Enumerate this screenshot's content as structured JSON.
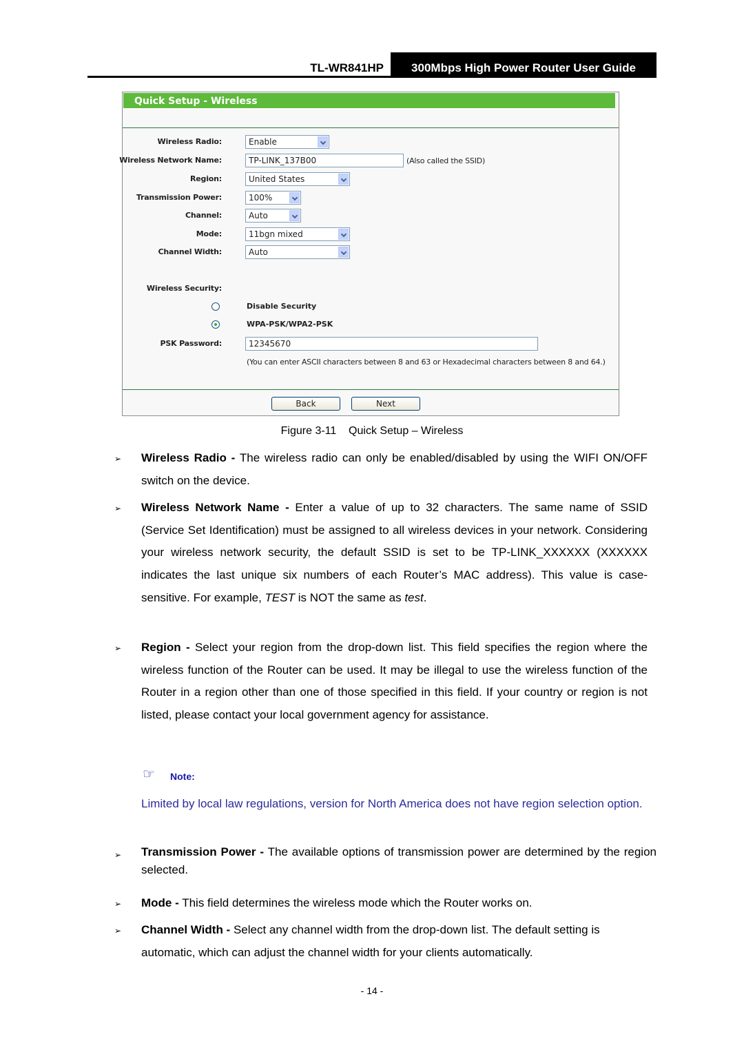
{
  "header": {
    "model": "TL-WR841HP",
    "guide_title": "300Mbps High Power Router User Guide"
  },
  "panel": {
    "title": "Quick Setup - Wireless",
    "fields": {
      "wireless_radio": {
        "label": "Wireless Radio:",
        "value": "Enable"
      },
      "network_name": {
        "label": "Wireless Network Name:",
        "value": "TP-LINK_137B00",
        "hint": "(Also called the SSID)"
      },
      "region": {
        "label": "Region:",
        "value": "United States"
      },
      "tx_power": {
        "label": "Transmission Power:",
        "value": "100%"
      },
      "channel": {
        "label": "Channel:",
        "value": "Auto"
      },
      "mode": {
        "label": "Mode:",
        "value": "11bgn mixed"
      },
      "channel_width": {
        "label": "Channel Width:",
        "value": "Auto"
      }
    },
    "security": {
      "label": "Wireless Security:",
      "options": [
        {
          "label": "Disable Security",
          "selected": false
        },
        {
          "label": "WPA-PSK/WPA2-PSK",
          "selected": true
        }
      ],
      "psk_label": "PSK Password:",
      "psk_value": "12345670",
      "psk_hint": "(You can enter ASCII characters between 8 and 63 or Hexadecimal characters between 8 and 64.)"
    },
    "buttons": {
      "back": "Back",
      "next": "Next"
    }
  },
  "caption": "Figure 3-11    Quick Setup – Wireless",
  "items": [
    {
      "term": "Wireless Radio -",
      "text": " The wireless radio can only be enabled/disabled by using the WIFI ON/OFF switch on the device."
    },
    {
      "term": "Wireless Network Name -",
      "text": " Enter a value of up to 32 characters. The same name of SSID (Service Set Identification) must be assigned to all wireless devices in your network. Considering your wireless network security, the default SSID is set to be TP-LINK_XXXXXX (XXXXXX indicates the last unique six numbers of each Router’s MAC address). This value is case-sensitive. For example, ",
      "em1": "TEST",
      "text2": " is NOT the same as ",
      "em2": "test",
      "text3": "."
    },
    {
      "term": "Region -",
      "text": " Select your region from the drop-down list. This field specifies the region where the wireless function of the Router can be used. It may be illegal to use the wireless function of the Router in a region other than one of those specified in this field. If your country or region is not listed, please contact your local government agency for assistance."
    },
    {
      "term": "Transmission Power -",
      "text": " The available options of transmission power are determined by the region selected."
    },
    {
      "term": "Mode -",
      "text": " This field determines the wireless mode which the Router works on."
    },
    {
      "term": "Channel Width -",
      "text": " Select any channel width from the drop-down list. The default setting is automatic, which can adjust the channel width for your clients automatically."
    }
  ],
  "note": {
    "icon": "pointing-hand-icon",
    "label": "Note:",
    "text": "Limited by local law regulations, version for North America does not have region selection option."
  },
  "bullet_glyph": "➢",
  "page_number": "- 14 -"
}
